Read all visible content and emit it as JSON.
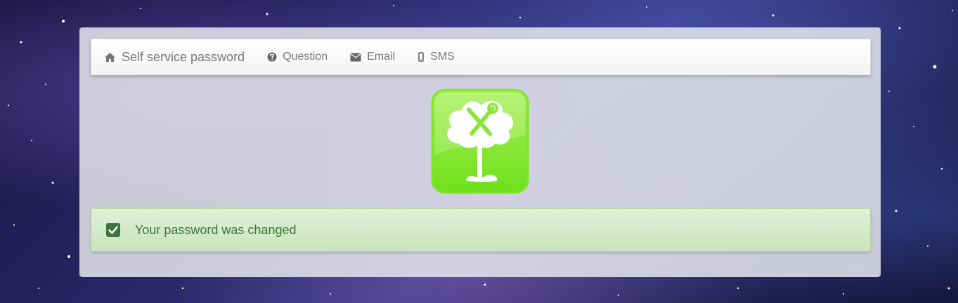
{
  "navbar": {
    "brand": "Self service password",
    "items": [
      {
        "label": "Question",
        "icon": "question-circle-icon"
      },
      {
        "label": "Email",
        "icon": "envelope-icon"
      },
      {
        "label": "SMS",
        "icon": "mobile-phone-icon"
      }
    ],
    "brand_icon": "home-icon"
  },
  "logo": {
    "icon": "tree-with-tools-logo",
    "color": "#7ee52a"
  },
  "alert": {
    "message": "Your password was changed",
    "icon": "check-square-icon",
    "color": "#3c763d",
    "background": "#dff0d8"
  }
}
